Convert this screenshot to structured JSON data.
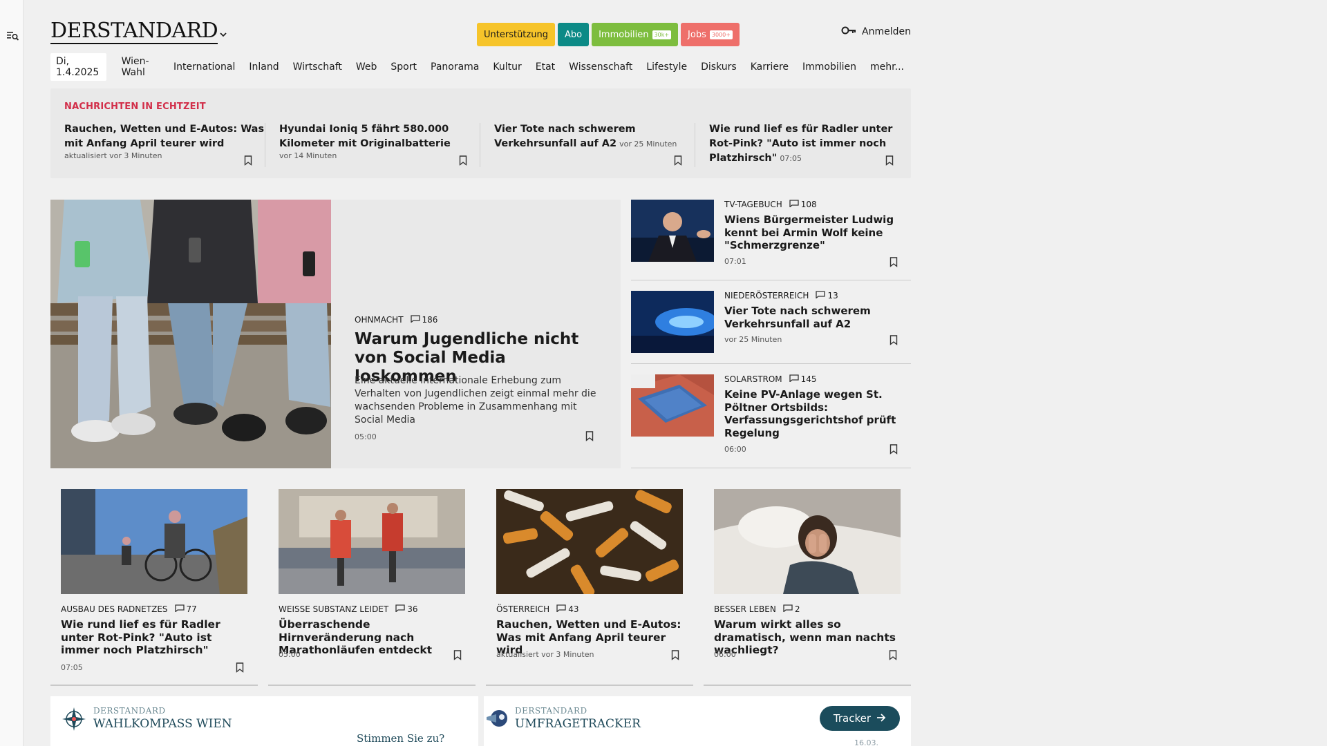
{
  "header": {
    "logo": "DERSTANDARD",
    "pills": [
      {
        "label": "Unterstützung"
      },
      {
        "label": "Abo"
      },
      {
        "label": "Immobilien",
        "tag": "30k+"
      },
      {
        "label": "Jobs",
        "tag": "3000+"
      }
    ],
    "login_label": "Anmelden"
  },
  "nav": {
    "date": "Di, 1.4.2025",
    "items": [
      "Wien-Wahl",
      "International",
      "Inland",
      "Wirtschaft",
      "Web",
      "Sport",
      "Panorama",
      "Kultur",
      "Etat",
      "Wissenschaft",
      "Lifestyle",
      "Diskurs",
      "Karriere",
      "Immobilien",
      "mehr..."
    ]
  },
  "ticker": {
    "title": "NACHRICHTEN IN ECHTZEIT",
    "items": [
      {
        "title": "Rauchen, Wetten und E-Autos: Was mit Anfang April teurer wird",
        "time": "aktualisiert vor 3 Minuten"
      },
      {
        "title": "Hyundai Ioniq 5 fährt 580.000 Kilometer mit Originalbatterie",
        "time": "vor 14 Minuten"
      },
      {
        "title": "Vier Tote nach schwerem Verkehrsunfall auf A2",
        "time": "vor 25 Minuten"
      },
      {
        "title": "Wie rund lief es für Radler unter Rot-Pink? \"Auto ist immer noch Platzhirsch\"",
        "time": "07:05"
      }
    ]
  },
  "lead": {
    "kicker": "OHNMACHT",
    "comments": "186",
    "title": "Warum Jugendliche nicht von Social Media loskommen",
    "teaser": "Eine aktuelle internationale Erhebung zum Verhalten von Jugendlichen zeigt einmal mehr die wachsenden Probleme in Zusammenhang mit Social Media",
    "time": "05:00"
  },
  "side": [
    {
      "kicker": "TV-TAGEBUCH",
      "comments": "108",
      "title": "Wiens Bürgermeister Ludwig kennt bei Armin Wolf keine \"Schmerzgrenze\"",
      "time": "07:01"
    },
    {
      "kicker": "NIEDERÖSTERREICH",
      "comments": "13",
      "title": "Vier Tote nach schwerem Verkehrsunfall auf A2",
      "time": "vor 25 Minuten"
    },
    {
      "kicker": "SOLARSTROM",
      "comments": "145",
      "title": "Keine PV-Anlage wegen St. Pöltner Ortsbilds: Verfassungsgerichtshof prüft Regelung",
      "time": "06:00"
    }
  ],
  "cards": [
    {
      "kicker": "AUSBAU DES RADNETZES",
      "comments": "77",
      "title": "Wie rund lief es für Radler unter Rot-Pink? \"Auto ist immer noch Platzhirsch\"",
      "time": "07:05"
    },
    {
      "kicker": "WEISSE SUBSTANZ LEIDET",
      "comments": "36",
      "title": "Überraschende Hirnveränderung nach Marathonläufen entdeckt",
      "time": "05:00"
    },
    {
      "kicker": "ÖSTERREICH",
      "comments": "43",
      "title": "Rauchen, Wetten und E-Autos: Was mit Anfang April teurer wird",
      "time": "aktualisiert vor 3 Minuten"
    },
    {
      "kicker": "BESSER LEBEN",
      "comments": "2",
      "title": "Warum wirkt alles so dramatisch, wenn man nachts wachliegt?",
      "time": "06:00"
    }
  ],
  "widgets": {
    "wahl": {
      "small": "DERSTANDARD",
      "big": "WAHLKOMPASS WIEN",
      "cta": "Stimmen Sie zu?"
    },
    "umfrage": {
      "small": "DERSTANDARD",
      "big": "UMFRAGETRACKER",
      "button": "Tracker",
      "date": "16.03."
    }
  },
  "colors": {
    "accent_red": "#d22e49",
    "teal": "#0c8a86",
    "yellow": "#f6c42a",
    "green": "#7dbd3e",
    "salmon": "#ee6f6a",
    "navy": "#1b4c5c"
  }
}
